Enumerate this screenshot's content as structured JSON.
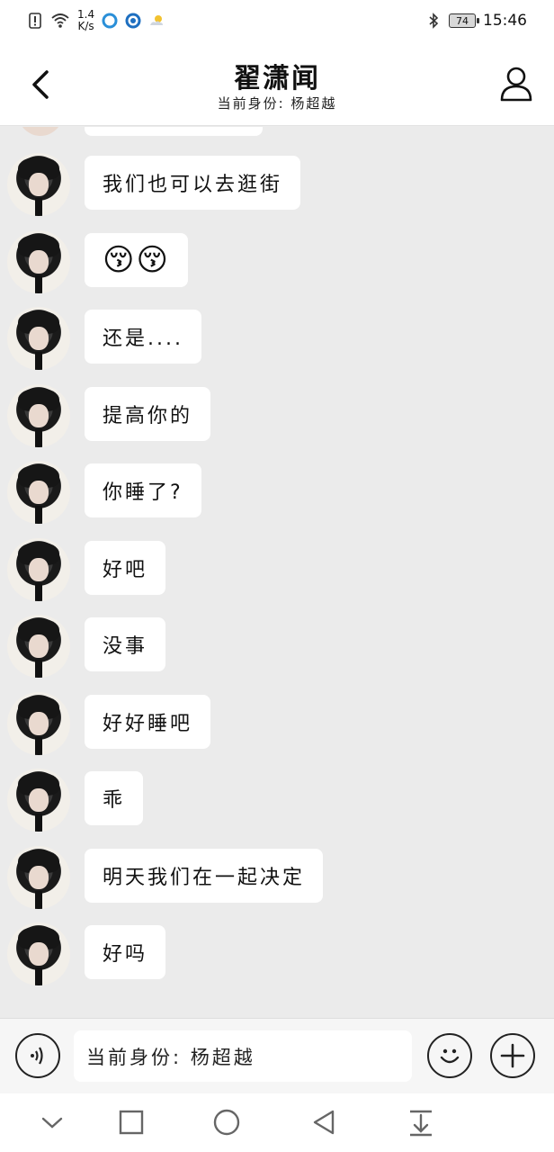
{
  "status_bar": {
    "net_speed_value": "1.4",
    "net_speed_unit": "K/s",
    "battery": "74",
    "time": "15:46"
  },
  "header": {
    "title": "翟潇闻",
    "subtitle": "当前身份: 杨超越"
  },
  "messages": [
    {
      "text": "我们也可以去逛街"
    },
    {
      "text": "😚😚",
      "emoji": true
    },
    {
      "text": "还是...."
    },
    {
      "text": "提高你的"
    },
    {
      "text": "你睡了?"
    },
    {
      "text": "好吧"
    },
    {
      "text": "没事"
    },
    {
      "text": "好好睡吧"
    },
    {
      "text": "乖"
    },
    {
      "text": "明天我们在一起决定"
    },
    {
      "text": "好吗"
    }
  ],
  "input": {
    "value": "当前身份: 杨超越"
  },
  "icons": {
    "back": "chevron-left-icon",
    "profile": "user-icon",
    "voice": "voice-icon",
    "emoji": "smiley-icon",
    "plus": "plus-icon"
  }
}
